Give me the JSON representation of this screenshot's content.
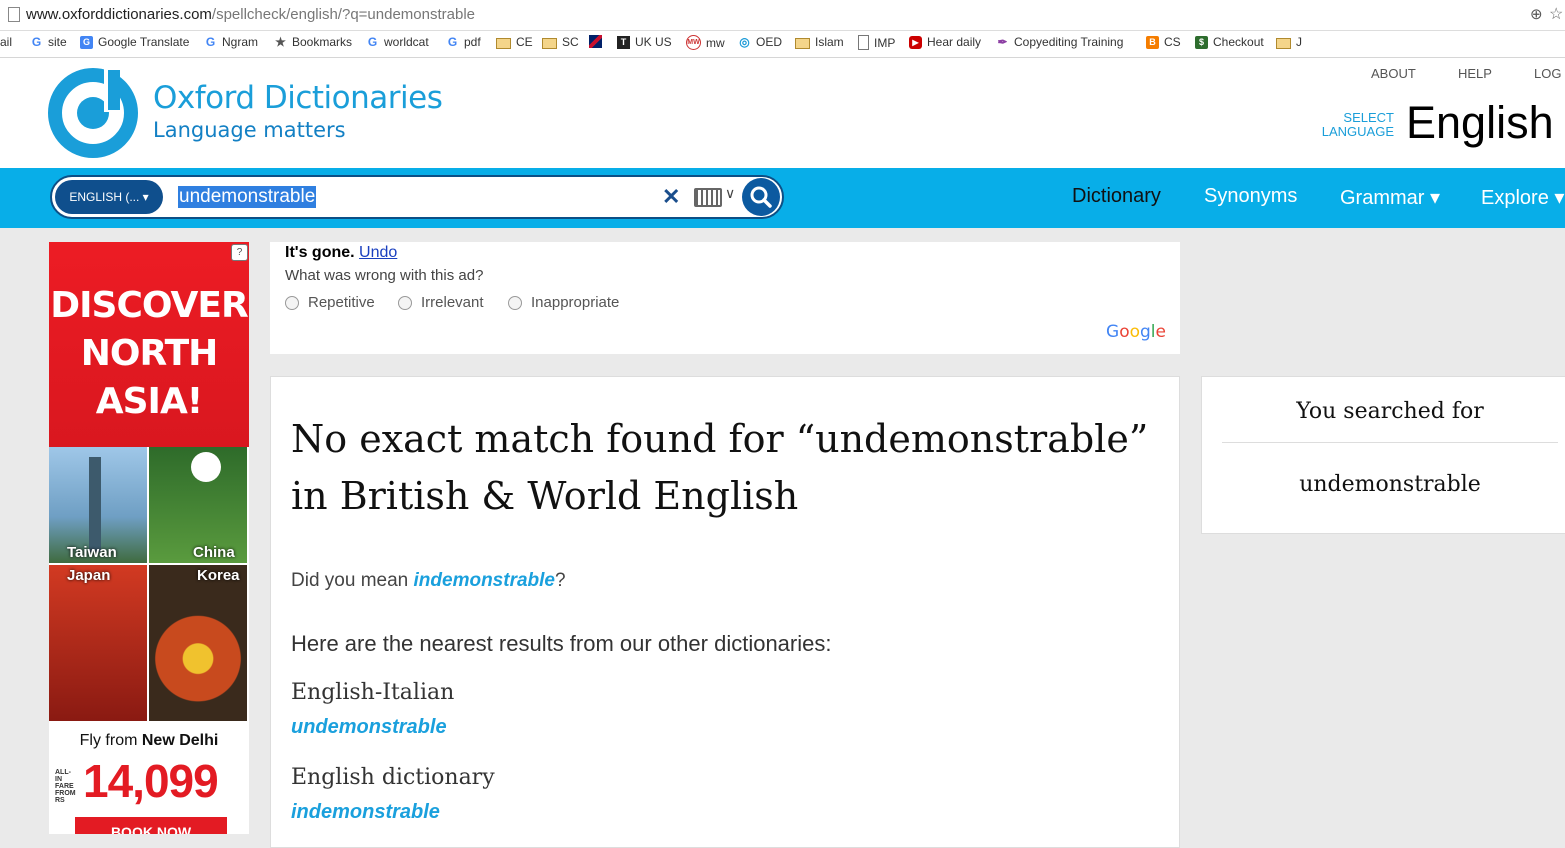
{
  "browser": {
    "url_host": "www.oxforddictionaries.com",
    "url_path": "/spellcheck/english/?q=undemonstrable",
    "bookmarks": [
      "ail",
      "site",
      "Google Translate",
      "Ngram",
      "Bookmarks",
      "worldcat",
      "pdf",
      "CE",
      "SC",
      "",
      "UK US",
      "mw",
      "OED",
      "Islam",
      "IMP",
      "Hear daily",
      "Copyediting Training",
      "CS",
      "Checkout",
      "J"
    ]
  },
  "header": {
    "brand_name": "Oxford Dictionaries",
    "brand_tagline": "Language matters",
    "top_links": [
      "ABOUT",
      "HELP",
      "LOG"
    ],
    "select_language": [
      "SELECT",
      "LANGUAGE"
    ],
    "language": "English ∨"
  },
  "search": {
    "lang_pill": "ENGLISH (... ▾",
    "value": "undemonstrable",
    "clear": "✕",
    "keyboard_arrow": "∨"
  },
  "nav": [
    "Dictionary",
    "Synonyms",
    "Grammar ▾",
    "Explore ▾"
  ],
  "ad_left": {
    "choice": "?",
    "headline": [
      "DISCOVER",
      "NORTH",
      "ASIA!"
    ],
    "tiles": [
      "Taiwan",
      "China",
      "Japan",
      "Korea"
    ],
    "fly_prefix": "Fly from ",
    "fly_city": "New Delhi",
    "fare_note": "ALL-IN FARE FROM RS",
    "price": "14,099",
    "cta": "BOOK NOW"
  },
  "ad_feedback": {
    "gone": "It's gone.",
    "undo": "Undo",
    "question": "What was wrong with this ad?",
    "options": [
      "Repetitive",
      "Irrelevant",
      "Inappropriate"
    ],
    "provider": "Google"
  },
  "main": {
    "heading": "No exact match found for “undemonstrable” in British & World English",
    "did_you_mean_prefix": "Did you mean ",
    "suggestion": "indemonstrable",
    "did_you_mean_suffix": "?",
    "nearest": "Here are the nearest results from our other dictionaries:",
    "results": [
      {
        "dictionary": "English-Italian",
        "word": "undemonstrable"
      },
      {
        "dictionary": "English dictionary",
        "word": "indemonstrable"
      }
    ]
  },
  "sidebar": {
    "title": "You searched for",
    "term": "undemonstrable"
  },
  "colors": {
    "brand_blue": "#08aee8",
    "link_blue": "#1aa0dd",
    "dark_navy": "#0c4f86",
    "ad_red": "#ed1c24"
  }
}
